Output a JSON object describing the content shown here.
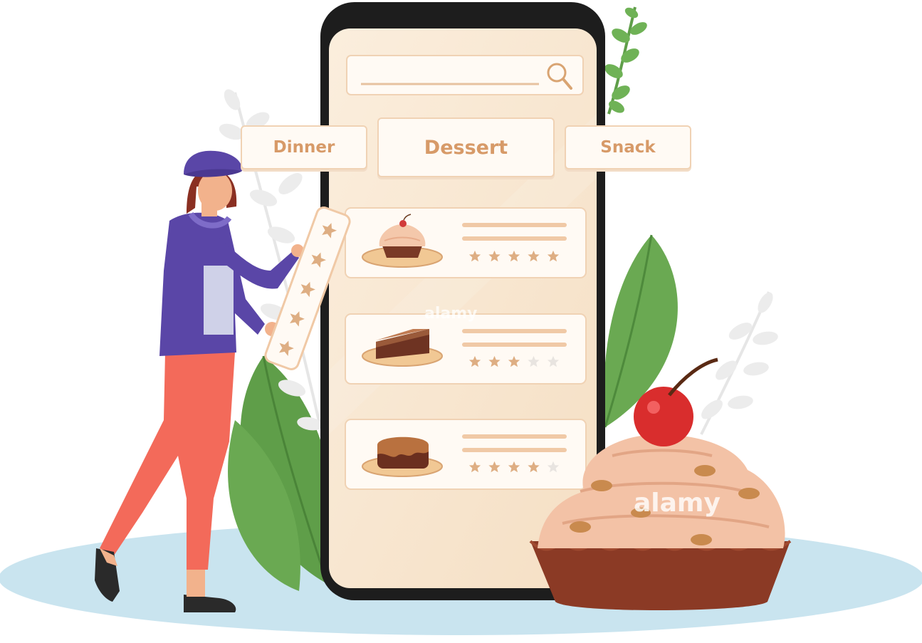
{
  "app": {
    "search": {
      "placeholder": ""
    },
    "tabs": [
      {
        "id": "dinner",
        "label": "Dinner"
      },
      {
        "id": "dessert",
        "label": "Dessert",
        "selected": true
      },
      {
        "id": "snack",
        "label": "Snack"
      }
    ],
    "items": [
      {
        "dessert": "cupcake",
        "rating": 5,
        "max_rating": 5
      },
      {
        "dessert": "cake-slice",
        "rating": 3,
        "max_rating": 5
      },
      {
        "dessert": "chocolate-cake",
        "rating": 4,
        "max_rating": 5
      }
    ],
    "rating_card": {
      "rating": 5,
      "max_rating": 5
    }
  },
  "watermarks": [
    "alamy",
    "alamy"
  ],
  "colors": {
    "accent": "#d9a472",
    "phone_screen": "#f8e6d0",
    "phone_frame": "#1d1d1d",
    "star_filled": "#deae83",
    "star_empty": "#e8e4e0",
    "floor": "#c9e4ef",
    "leaf": "#66a64f"
  }
}
